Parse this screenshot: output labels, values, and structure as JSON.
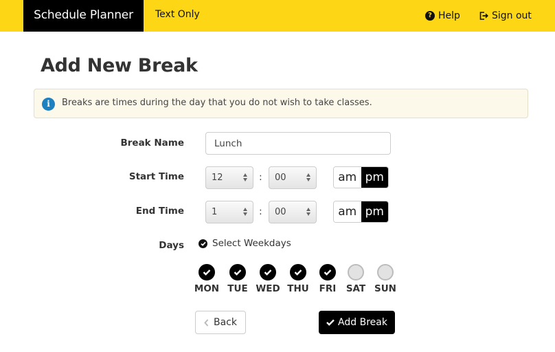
{
  "header": {
    "brand": "Schedule Planner",
    "text_only_link": "Text Only",
    "help_link": "Help",
    "signout_link": "Sign out",
    "bar_color": "#fdd716"
  },
  "page": {
    "title": "Add New Break",
    "info_message": "Breaks are times during the day that you do not wish to take classes."
  },
  "form": {
    "break_name": {
      "label": "Break Name",
      "value": "Lunch"
    },
    "start_time": {
      "label": "Start Time",
      "hour": "12",
      "minute": "00",
      "separator": ":",
      "am_label": "am",
      "pm_label": "pm",
      "selected_period": "pm"
    },
    "end_time": {
      "label": "End Time",
      "hour": "1",
      "minute": "00",
      "separator": ":",
      "am_label": "am",
      "pm_label": "pm",
      "selected_period": "pm"
    },
    "days": {
      "label": "Days",
      "select_weekdays_label": "Select Weekdays",
      "select_weekdays_checked": true,
      "items": [
        {
          "label": "MON",
          "checked": true
        },
        {
          "label": "TUE",
          "checked": true
        },
        {
          "label": "WED",
          "checked": true
        },
        {
          "label": "THU",
          "checked": true
        },
        {
          "label": "FRI",
          "checked": true
        },
        {
          "label": "SAT",
          "checked": false
        },
        {
          "label": "SUN",
          "checked": false
        }
      ]
    }
  },
  "actions": {
    "back_label": "Back",
    "add_label": "Add Break"
  }
}
